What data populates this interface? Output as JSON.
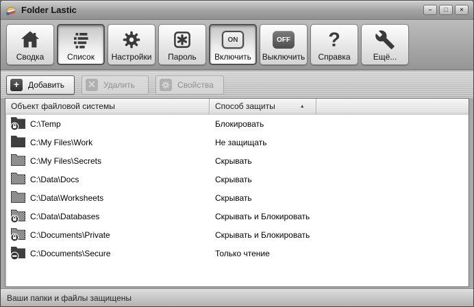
{
  "window": {
    "title": "Folder Lastic",
    "controls": {
      "minimize": "–",
      "maximize": "□",
      "close": "×"
    }
  },
  "toolbar": [
    {
      "id": "summary",
      "label": "Сводка",
      "icon": "home-icon",
      "pressed": false
    },
    {
      "id": "list",
      "label": "Список",
      "icon": "list-icon",
      "pressed": true
    },
    {
      "id": "settings",
      "label": "Настройки",
      "icon": "gear-icon",
      "pressed": false
    },
    {
      "id": "password",
      "label": "Пароль",
      "icon": "asterisk-icon",
      "pressed": false
    },
    {
      "id": "enable",
      "label": "Включить",
      "icon": "on-badge-icon",
      "badge": "ON",
      "badge_style": "outline",
      "pressed": true
    },
    {
      "id": "disable",
      "label": "Выключить",
      "icon": "off-badge-icon",
      "badge": "OFF",
      "badge_style": "solid",
      "pressed": false
    },
    {
      "id": "help",
      "label": "Справка",
      "icon": "question-icon",
      "pressed": false
    },
    {
      "id": "more",
      "label": "Ещё...",
      "icon": "wrench-icon",
      "pressed": false
    }
  ],
  "actions": [
    {
      "id": "add",
      "label": "Добавить",
      "icon": "plus-icon",
      "enabled": true
    },
    {
      "id": "delete",
      "label": "Удалить",
      "icon": "cross-icon",
      "enabled": false
    },
    {
      "id": "properties",
      "label": "Свойства",
      "icon": "gear-icon",
      "enabled": false
    }
  ],
  "table": {
    "columns": [
      {
        "label": "Объект файловой системы",
        "sort": null
      },
      {
        "label": "Способ защиты",
        "sort": "asc"
      },
      {
        "label": "",
        "sort": null
      }
    ],
    "sort_indicator": "▲",
    "rows": [
      {
        "icon": "folder-locked-icon",
        "path": "C:\\Temp",
        "protection": "Блокировать"
      },
      {
        "icon": "folder-icon",
        "path": "C:\\My Files\\Work",
        "protection": "Не защищать"
      },
      {
        "icon": "folder-hidden-icon",
        "path": "C:\\My Files\\Secrets",
        "protection": "Скрывать"
      },
      {
        "icon": "folder-hidden-icon",
        "path": "C:\\Data\\Docs",
        "protection": "Скрывать"
      },
      {
        "icon": "folder-hidden-icon",
        "path": "C:\\Data\\Worksheets",
        "protection": "Скрывать"
      },
      {
        "icon": "folder-hidden-locked-icon",
        "path": "C:\\Data\\Databases",
        "protection": "Скрывать и Блокировать"
      },
      {
        "icon": "folder-hidden-locked-icon",
        "path": "C:\\Documents\\Private",
        "protection": "Скрывать и Блокировать"
      },
      {
        "icon": "folder-readonly-icon",
        "path": "C:\\Documents\\Secure",
        "protection": "Только чтение"
      }
    ]
  },
  "statusbar": {
    "text": "Ваши папки и файлы защищены"
  },
  "colors": {
    "icon_dark": "#3a3a3a",
    "window_gray": "#a8a8a8",
    "brand_yellow": "#f2c53d",
    "brand_red": "#d84a3a",
    "brand_blue": "#3a71c1"
  }
}
